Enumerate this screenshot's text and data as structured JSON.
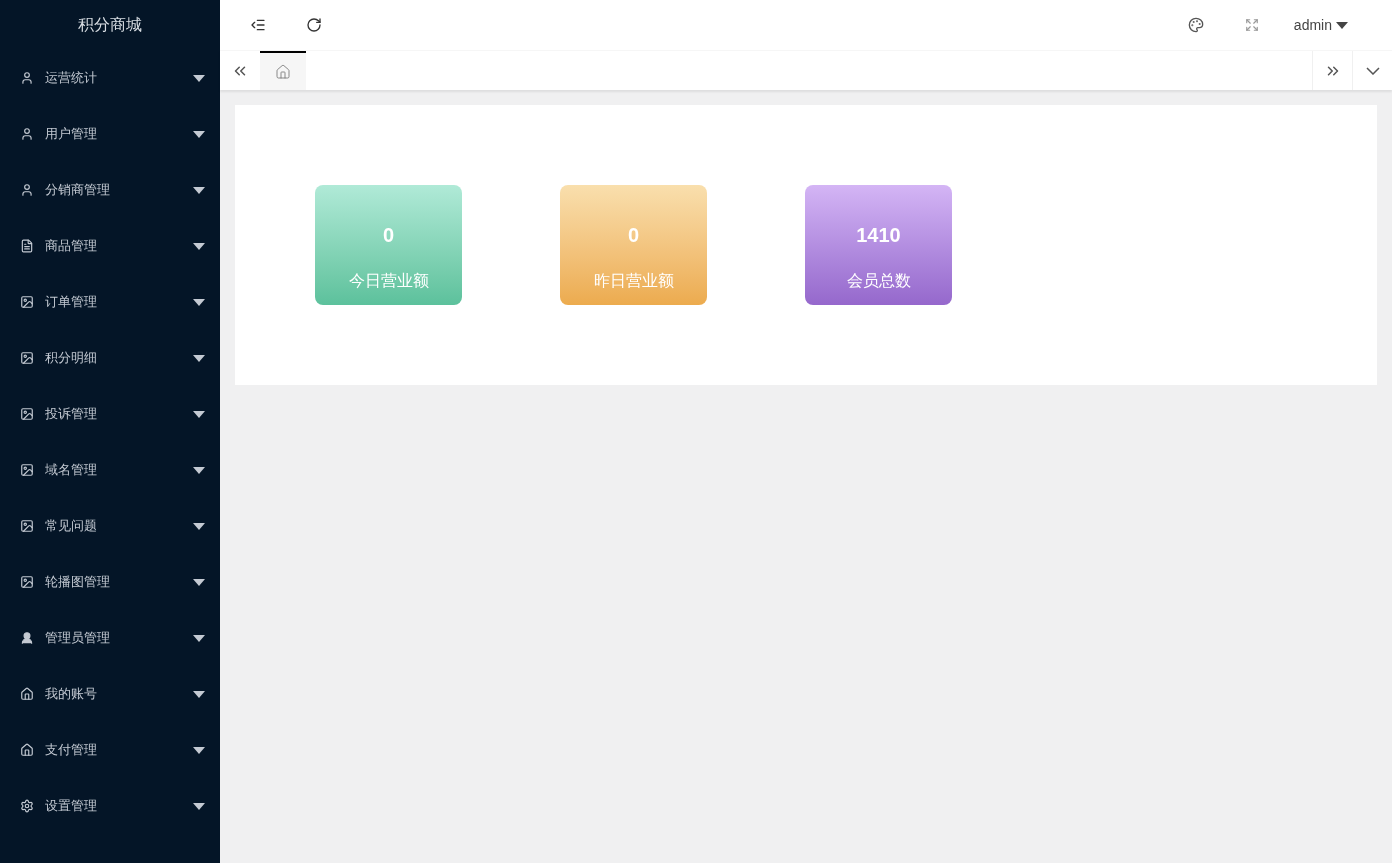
{
  "sidebar": {
    "title": "积分商城",
    "items": [
      {
        "label": "运营统计",
        "kind": "user",
        "expanded": false
      },
      {
        "label": "用户管理",
        "kind": "user",
        "expanded": false
      },
      {
        "label": "分销商管理",
        "kind": "user",
        "expanded": false
      },
      {
        "label": "商品管理",
        "kind": "file",
        "expanded": false
      },
      {
        "label": "订单管理",
        "kind": "image",
        "expanded": false
      },
      {
        "label": "积分明细",
        "kind": "image",
        "expanded": false
      },
      {
        "label": "投诉管理",
        "kind": "image",
        "expanded": false
      },
      {
        "label": "域名管理",
        "kind": "image",
        "expanded": false
      },
      {
        "label": "常见问题",
        "kind": "image",
        "expanded": false
      },
      {
        "label": "轮播图管理",
        "kind": "image",
        "expanded": false
      },
      {
        "label": "管理员管理",
        "kind": "person",
        "expanded": false
      },
      {
        "label": "我的账号",
        "kind": "home",
        "expanded": false
      },
      {
        "label": "支付管理",
        "kind": "home",
        "expanded": false
      },
      {
        "label": "设置管理",
        "kind": "gear",
        "expanded": false
      }
    ]
  },
  "header": {
    "user": "admin"
  },
  "tabs": [
    {
      "kind": "home",
      "selected": true
    }
  ],
  "stats": [
    {
      "value": "0",
      "label": "今日营业额",
      "kind": "green"
    },
    {
      "value": "0",
      "label": "昨日营业额",
      "kind": "orange"
    },
    {
      "value": "1410",
      "label": "会员总数",
      "kind": "purple"
    }
  ]
}
